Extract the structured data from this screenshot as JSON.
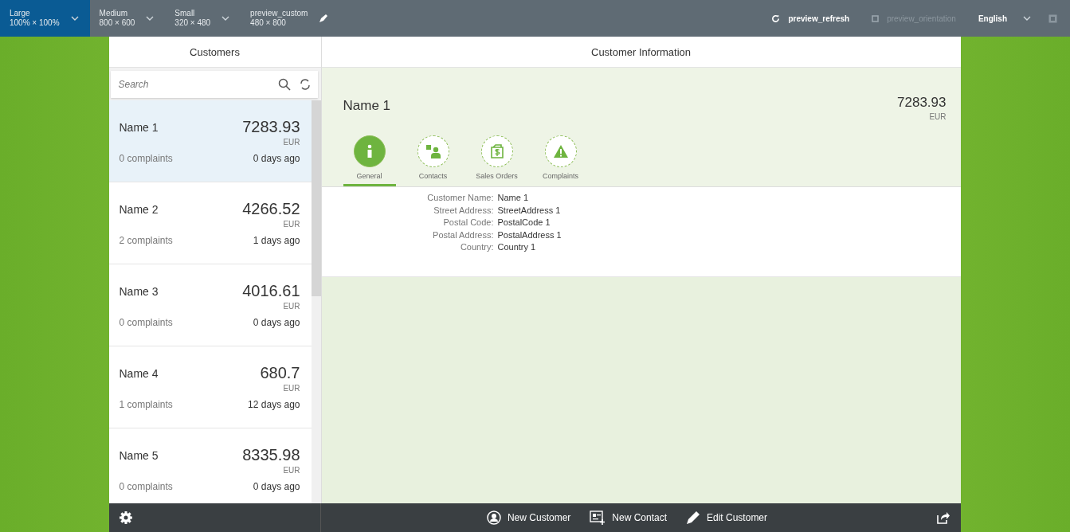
{
  "toolbar": {
    "devices": [
      {
        "label": "Large",
        "size": "100% × 100%",
        "selected": true
      },
      {
        "label": "Medium",
        "size": "800 × 600",
        "selected": false
      },
      {
        "label": "Small",
        "size": "320 × 480",
        "selected": false
      },
      {
        "label": "preview_custom",
        "size": "480 × 800",
        "selected": false
      }
    ],
    "refresh": {
      "label": "preview_refresh",
      "disabled": false
    },
    "orientation": {
      "label": "preview_orientation",
      "disabled": true
    },
    "language": {
      "label": "English"
    }
  },
  "master": {
    "title": "Customers",
    "search": {
      "placeholder": "Search"
    },
    "items": [
      {
        "name": "Name 1",
        "amount": "7283.93",
        "currency": "EUR",
        "complaints": "0 complaints",
        "age": "0 days ago",
        "selected": true
      },
      {
        "name": "Name 2",
        "amount": "4266.52",
        "currency": "EUR",
        "complaints": "2 complaints",
        "age": "1 days ago",
        "selected": false
      },
      {
        "name": "Name 3",
        "amount": "4016.61",
        "currency": "EUR",
        "complaints": "0 complaints",
        "age": "0 days ago",
        "selected": false
      },
      {
        "name": "Name 4",
        "amount": "680.7",
        "currency": "EUR",
        "complaints": "1 complaints",
        "age": "12 days ago",
        "selected": false
      },
      {
        "name": "Name 5",
        "amount": "8335.98",
        "currency": "EUR",
        "complaints": "0 complaints",
        "age": "0 days ago",
        "selected": false
      }
    ]
  },
  "detail": {
    "title": "Customer Information",
    "name": "Name 1",
    "amount": "7283.93",
    "currency": "EUR",
    "tabs": [
      {
        "label": "General",
        "kind": "info",
        "selected": true
      },
      {
        "label": "Contacts",
        "kind": "contacts",
        "selected": false
      },
      {
        "label": "Sales Orders",
        "kind": "orders",
        "selected": false
      },
      {
        "label": "Complaints",
        "kind": "warning",
        "selected": false
      }
    ],
    "fields": [
      {
        "label": "Customer Name:",
        "value": "Name 1"
      },
      {
        "label": "Street Address:",
        "value": "StreetAddress 1"
      },
      {
        "label": "Postal Code:",
        "value": "PostalCode 1"
      },
      {
        "label": "Postal Address:",
        "value": "PostalAddress 1"
      },
      {
        "label": "Country:",
        "value": "Country 1"
      }
    ]
  },
  "footer": {
    "buttons": [
      {
        "label": "New Customer",
        "kind": "person"
      },
      {
        "label": "New Contact",
        "kind": "contact"
      },
      {
        "label": "Edit Customer",
        "kind": "edit"
      }
    ]
  }
}
